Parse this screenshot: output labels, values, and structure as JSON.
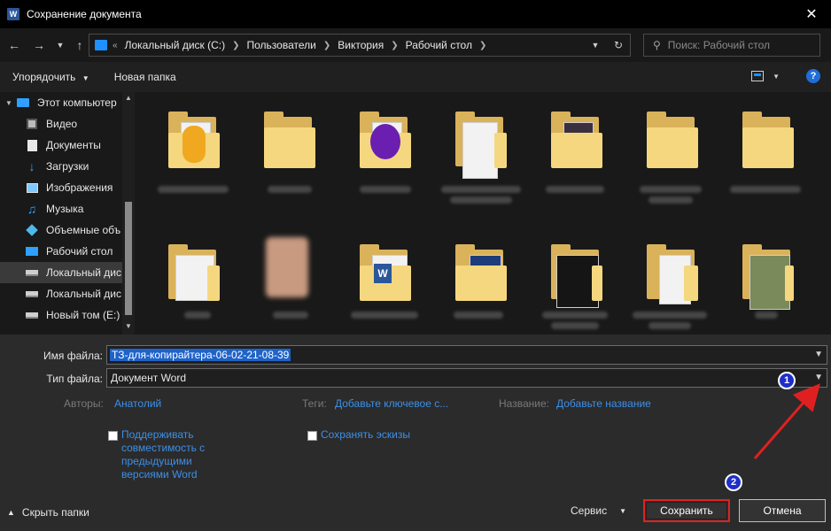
{
  "window": {
    "title": "Сохранение документа",
    "app_icon_letter": "W",
    "close_glyph": "✕"
  },
  "address": {
    "overflow": "«",
    "crumbs": [
      "Локальный диск (C:)",
      "Пользователи",
      "Виктория",
      "Рабочий стол"
    ]
  },
  "search": {
    "placeholder": "Поиск: Рабочий стол"
  },
  "toolbar": {
    "organize_label": "Упорядочить",
    "new_folder_label": "Новая папка",
    "help_glyph": "?"
  },
  "sidebar": {
    "items": [
      {
        "label": "Этот компьютер",
        "icon": "computer-icon"
      },
      {
        "label": "Видео",
        "icon": "video-icon"
      },
      {
        "label": "Документы",
        "icon": "documents-icon"
      },
      {
        "label": "Загрузки",
        "icon": "downloads-icon"
      },
      {
        "label": "Изображения",
        "icon": "images-icon"
      },
      {
        "label": "Музыка",
        "icon": "music-icon"
      },
      {
        "label": "Объемные объ",
        "icon": "3d-objects-icon"
      },
      {
        "label": "Рабочий стол",
        "icon": "desktop-icon"
      },
      {
        "label": "Локальный дис",
        "icon": "drive-icon"
      },
      {
        "label": "Локальный дис",
        "icon": "drive-icon"
      },
      {
        "label": "Новый том (E:)",
        "icon": "drive-icon"
      }
    ]
  },
  "form": {
    "filename_label": "Имя файла:",
    "filename_value": "ТЗ-для-копирайтера-06-02-21-08-39",
    "filetype_label": "Тип файла:",
    "filetype_value": "Документ Word",
    "authors_label": "Авторы:",
    "authors_value": "Анатолий",
    "tags_label": "Теги:",
    "tags_value": "Добавьте ключевое с...",
    "title_label": "Название:",
    "title_value": "Добавьте название",
    "compat_label": "Поддерживать совместимость с предыдущими версиями Word",
    "thumbs_label": "Сохранять эскизы"
  },
  "footer": {
    "hide_folders_label": "Скрыть папки",
    "service_label": "Сервис",
    "save_label": "Сохранить",
    "cancel_label": "Отмена"
  },
  "annotations": {
    "badge1": "1",
    "badge2": "2",
    "color_red": "#e02020",
    "color_badge": "#1f2ec8"
  }
}
